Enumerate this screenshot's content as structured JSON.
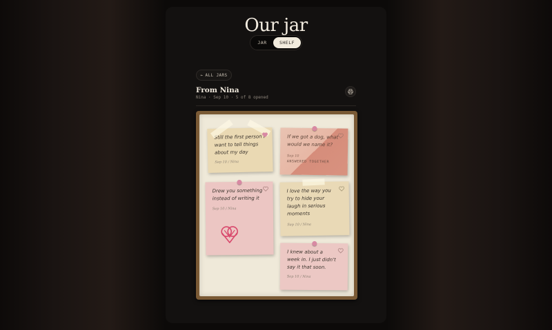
{
  "app": {
    "title": "Our jar",
    "tabs": [
      {
        "label": "JAR",
        "active": false
      },
      {
        "label": "SHELF",
        "active": true
      }
    ]
  },
  "nav": {
    "back_label": "ALL JARS",
    "back_icon": "arrow-left-icon"
  },
  "jar": {
    "title": "From Nina",
    "meta": "Nina · Sep 10 · 5 of 8 opened",
    "print_icon": "printer-icon"
  },
  "notes": [
    {
      "text": "Still the first person I want to tell things about my day",
      "meta": "Sep 10 / Nina",
      "color": "#ead9b3",
      "liked": true,
      "tag": ""
    },
    {
      "text": "If we got a dog, what would we name it?",
      "meta": "Sep 10",
      "color": "#e8b4a4",
      "liked": false,
      "tag": "ANSWERED TOGETHER"
    },
    {
      "text": "Drew you something instead of writing it",
      "meta": "Sep 10 / Nina",
      "color": "#ecc6c3",
      "liked": false,
      "tag": ""
    },
    {
      "text": "I love the way you try to hide your laugh in serious moments",
      "meta": "Sep 10 / Nina",
      "color": "#e9d9b6",
      "liked": false,
      "tag": ""
    },
    {
      "text": "I knew about a week in. I just didn't say it that soon.",
      "meta": "Sep 10 / Nina",
      "color": "#ecc8c4",
      "liked": false,
      "tag": ""
    }
  ],
  "colors": {
    "accent_pink": "#d889a3",
    "doodle": "#d8476b",
    "board_frame": "#7a5a35"
  }
}
